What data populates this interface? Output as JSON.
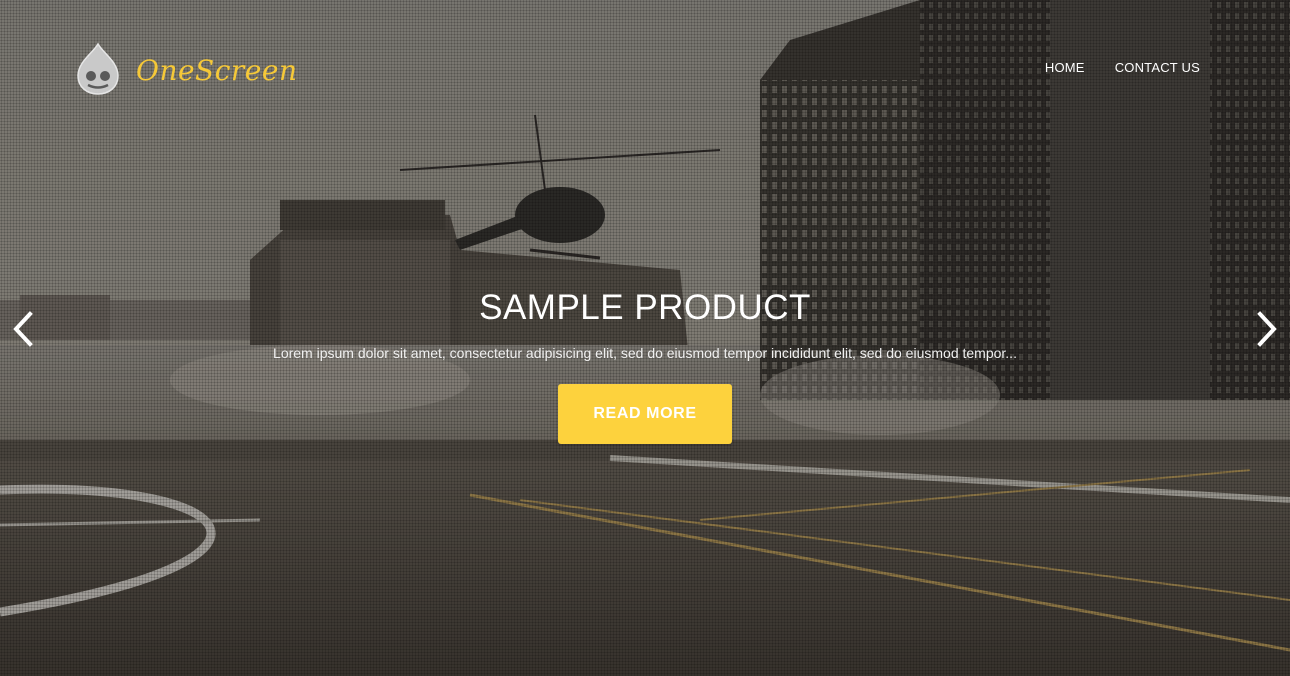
{
  "brand": {
    "name": "OneScreen",
    "icon": "drupal-drop-icon",
    "color": "#f5c838"
  },
  "nav": {
    "items": [
      {
        "label": "HOME"
      },
      {
        "label": "CONTACT US"
      }
    ]
  },
  "slide": {
    "title": "SAMPLE PRODUCT",
    "description": "Lorem ipsum dolor sit amet, consectetur adipisicing elit, sed do eiusmod tempor incididunt elit, sed do eiusmod tempor...",
    "button_label": "READ MORE",
    "button_color": "#fdd23d"
  },
  "controls": {
    "prev_icon": "chevron-left-icon",
    "next_icon": "chevron-right-icon"
  }
}
